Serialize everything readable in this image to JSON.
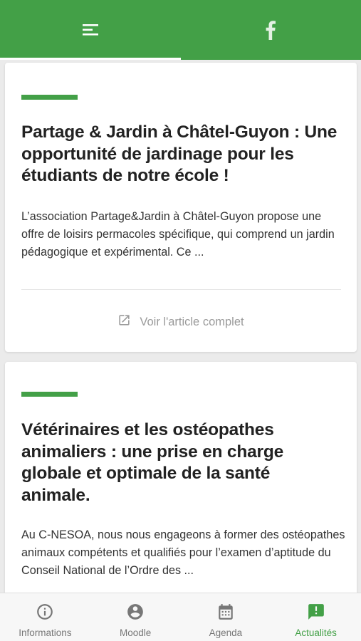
{
  "colors": {
    "brand_green": "#43a047",
    "active_tab_indicator": "#ffffff",
    "inactive_nav": "#777777"
  },
  "top_tabs": [
    {
      "icon": "menu-lines-icon",
      "active": true
    },
    {
      "icon": "facebook-icon",
      "active": false
    }
  ],
  "articles": [
    {
      "title": "Partage & Jardin à Châtel-Guyon : Une opportunité de jardinage pour les étudiants de notre école !",
      "excerpt": "L’association Partage&Jardin à Châtel-Guyon propose une offre de loisirs permacoles spécifique, qui comprend un jardin pédagogique et expérimental. Ce ...",
      "read_more": "Voir l'article complet"
    },
    {
      "title": "Vétérinaires et les ostéopathes animaliers : une prise en charge globale et optimale de la santé animale.",
      "excerpt": "Au C-NESOA, nous nous engageons à former des ostéopathes animaux compétents et qualifiés pour l’examen d’aptitude du Conseil National de l’Ordre des ..."
    }
  ],
  "bottom_nav": [
    {
      "label": "Informations",
      "icon": "info-circle-icon",
      "active": false
    },
    {
      "label": "Moodle",
      "icon": "account-circle-icon",
      "active": false
    },
    {
      "label": "Agenda",
      "icon": "calendar-icon",
      "active": false
    },
    {
      "label": "Actualités",
      "icon": "message-alert-icon",
      "active": true
    }
  ]
}
